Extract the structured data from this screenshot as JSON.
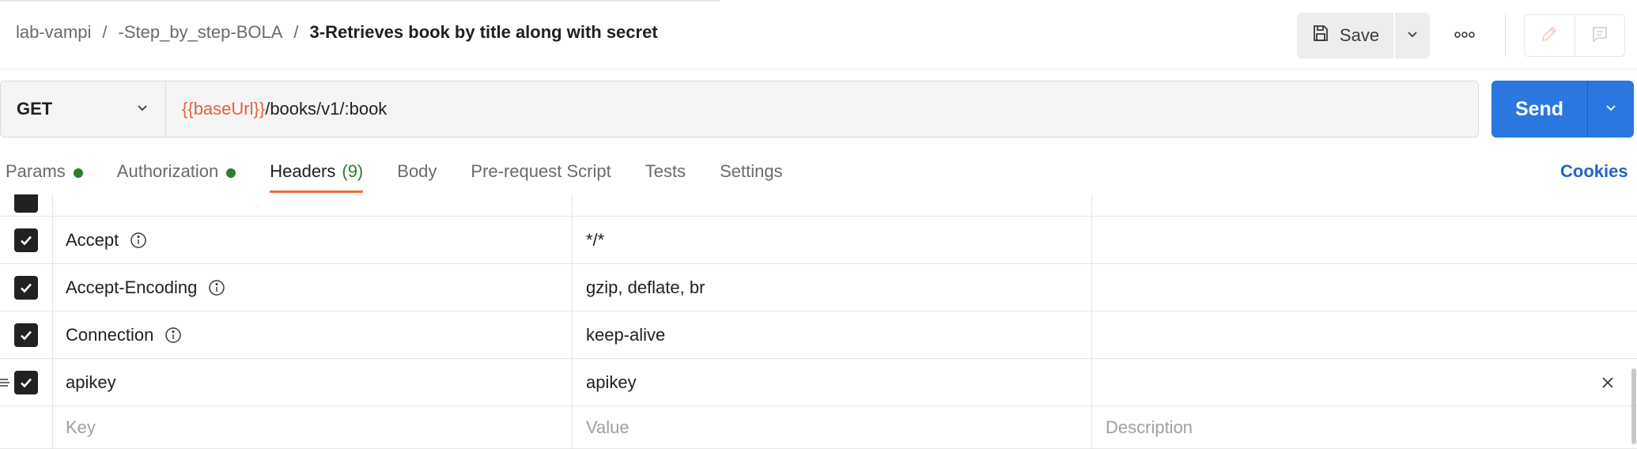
{
  "breadcrumb": {
    "items": [
      "lab-vampi",
      "-Step_by_step-BOLA"
    ],
    "separator": "/",
    "current": "3-Retrieves book by title along with secret"
  },
  "toolbar": {
    "save_label": "Save",
    "save_icon": "floppy-disk-icon",
    "more_icon": "more-horizontal-icon",
    "edit_icon": "pencil-icon",
    "comments_icon": "comment-icon"
  },
  "request": {
    "method": "GET",
    "url_variable": "{{baseUrl}}",
    "url_path": "/books/v1/:book",
    "send_label": "Send"
  },
  "tabs": [
    {
      "label": "Params",
      "dot": true
    },
    {
      "label": "Authorization",
      "dot": true
    },
    {
      "label": "Headers",
      "count": "(9)",
      "active": true
    },
    {
      "label": "Body"
    },
    {
      "label": "Pre-request Script"
    },
    {
      "label": "Tests"
    },
    {
      "label": "Settings"
    }
  ],
  "cookies_label": "Cookies",
  "headers_table": {
    "rows": [
      {
        "key": "Accept",
        "value": "*/*",
        "checked": true,
        "info": true
      },
      {
        "key": "Accept-Encoding",
        "value": "gzip, deflate, br",
        "checked": true,
        "info": true
      },
      {
        "key": "Connection",
        "value": "keep-alive",
        "checked": true,
        "info": true
      },
      {
        "key": "apikey",
        "value": "apikey",
        "checked": true,
        "info": false
      }
    ],
    "placeholders": {
      "key": "Key",
      "value": "Value",
      "description": "Description"
    }
  },
  "colors": {
    "accent_orange": "#ef6c3a",
    "variable_orange": "#e1643a",
    "send_blue": "#2b77e0",
    "status_green": "#2e7d32",
    "link_blue": "#1f64c8"
  }
}
